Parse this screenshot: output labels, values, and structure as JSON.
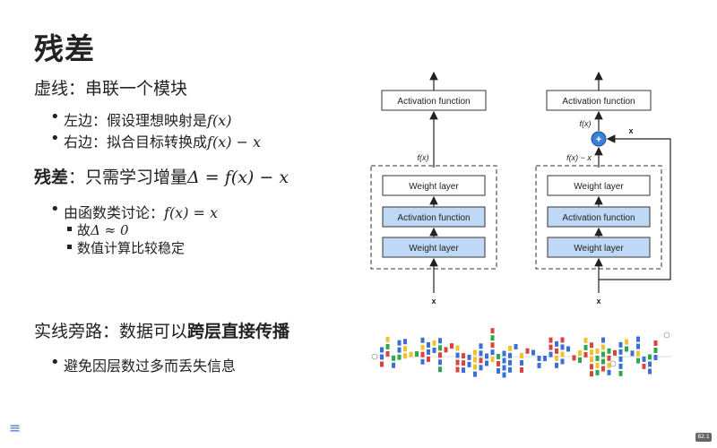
{
  "slide": {
    "title": "残差",
    "section1": {
      "heading": "虚线：串联一个模块",
      "bullets": [
        {
          "text": "左边：假设理想映射是",
          "math": "f(x)"
        },
        {
          "text": "右边：拟合目标转换成",
          "math": "f(x) − x"
        }
      ]
    },
    "section2": {
      "heading_bold": "残差",
      "heading_rest": "：只需学习增量",
      "heading_math": "Δ = f(x) − x",
      "bullet": {
        "text": "由函数类讨论：",
        "math": "f(x) = x"
      },
      "subs": [
        {
          "text": "故",
          "math": "Δ ≈ 0"
        },
        {
          "text": "数值计算比较稳定",
          "math": ""
        }
      ]
    },
    "section3": {
      "heading_prefix": "实线旁路：数据可以",
      "heading_bold": "跨层直接传播",
      "bullet": "避免因层数过多而丢失信息"
    },
    "page_number": "82.1"
  },
  "diagram": {
    "left": {
      "top_label": "Activation function",
      "boxes": [
        "Weight layer",
        "Activation function",
        "Weight layer"
      ],
      "output_label": "f(x)",
      "input_label": "x"
    },
    "right": {
      "top_label": "Activation function",
      "boxes": [
        "Weight layer",
        "Activation function",
        "Weight layer"
      ],
      "output_label": "f(x)",
      "residual_label": "f(x) − x",
      "skip_label": "x",
      "input_label": "x",
      "plus": "+"
    }
  },
  "icons": {
    "menu": "menu-icon"
  },
  "colors": {
    "box_blue": "#bfd8f5",
    "plus_blue": "#3a7fd9"
  }
}
